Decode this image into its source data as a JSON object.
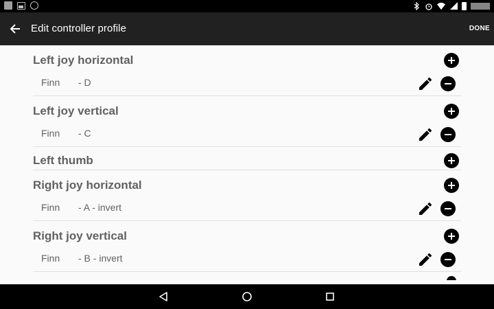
{
  "app_bar": {
    "title": "Edit controller profile",
    "done_label": "DONE"
  },
  "icons": {
    "back": "arrow-back-icon",
    "add": "add-circle-icon",
    "remove": "remove-circle-icon",
    "edit": "pencil-icon",
    "nav_back": "triangle-back-icon",
    "nav_home": "circle-home-icon",
    "nav_recents": "square-recents-icon"
  },
  "colors": {
    "app_bar": "#212121",
    "content_bg": "#fafafa",
    "header_text": "#616161",
    "icon": "#000000"
  },
  "groups": [
    {
      "label": "Left joy horizontal",
      "bindings": [
        {
          "name": "Finn",
          "detail": "- D"
        }
      ]
    },
    {
      "label": "Left joy vertical",
      "bindings": [
        {
          "name": "Finn",
          "detail": "- C"
        }
      ]
    },
    {
      "label": "Left thumb",
      "bindings": []
    },
    {
      "label": "Right joy horizontal",
      "bindings": [
        {
          "name": "Finn",
          "detail": "- A - invert"
        }
      ]
    },
    {
      "label": "Right joy vertical",
      "bindings": [
        {
          "name": "Finn",
          "detail": "- B - invert"
        }
      ]
    }
  ]
}
